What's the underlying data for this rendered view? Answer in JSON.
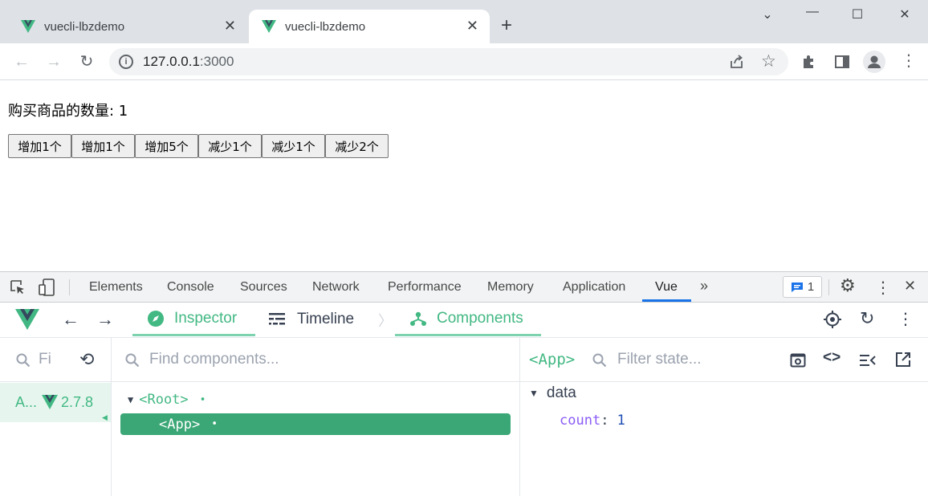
{
  "browser": {
    "tabs": [
      {
        "title": "vuecli-lbzdemo",
        "active": false
      },
      {
        "title": "vuecli-lbzdemo",
        "active": true
      }
    ],
    "url_host": "127.0.0.1",
    "url_port": ":3000"
  },
  "page": {
    "heading": "购买商品的数量: 1",
    "buttons": [
      "增加1个",
      "增加1个",
      "增加5个",
      "减少1个",
      "减少1个",
      "减少2个"
    ]
  },
  "devtools": {
    "tabs": [
      "Elements",
      "Console",
      "Sources",
      "Network",
      "Performance",
      "Memory",
      "Application",
      "Vue"
    ],
    "active_tab": "Vue",
    "issues_count": "1",
    "vue": {
      "tabs": [
        "Inspector",
        "Timeline",
        "Components"
      ],
      "app_filter_placeholder": "Fi",
      "app_entry_label": "A...",
      "vue_version": "2.7.8",
      "find_components_placeholder": "Find components...",
      "tree": [
        {
          "label": "<Root>",
          "selected": false
        },
        {
          "label": "<App>",
          "selected": true
        }
      ],
      "state_title": "<App>",
      "filter_state_placeholder": "Filter state...",
      "state_section": "data",
      "state_key": "count",
      "state_value": "1"
    }
  },
  "colors": {
    "vue_green": "#42b883",
    "selection_green": "#3ba776",
    "chrome_tabstrip": "#dee1e6",
    "devtools_accent": "#1a73e8"
  }
}
